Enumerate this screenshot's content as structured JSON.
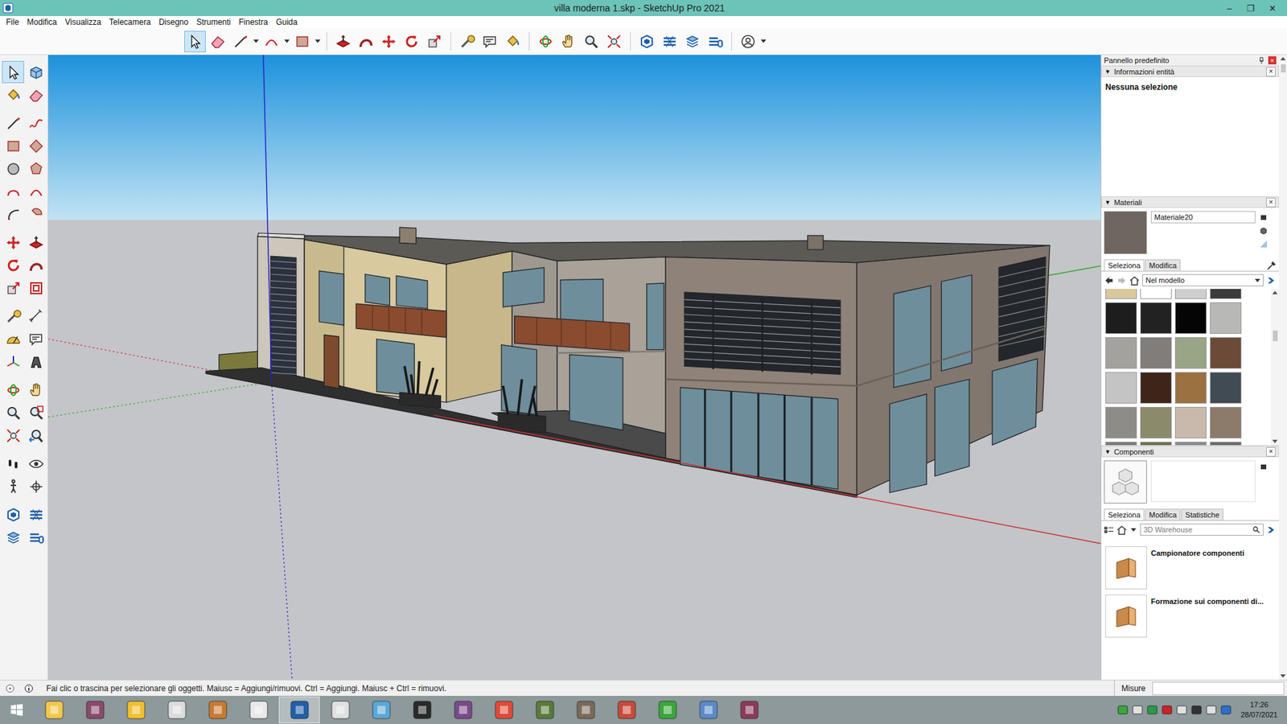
{
  "window": {
    "title": "villa moderna 1.skp - SketchUp Pro 2021",
    "controls": [
      "–",
      "❐",
      "✕"
    ]
  },
  "menu": [
    {
      "label": "File"
    },
    {
      "label": "Modifica"
    },
    {
      "label": "Visualizza"
    },
    {
      "label": "Telecamera"
    },
    {
      "label": "Disegno"
    },
    {
      "label": "Strumenti"
    },
    {
      "label": "Finestra"
    },
    {
      "label": "Guida"
    }
  ],
  "toolbar": [
    {
      "selected": true,
      "dropdown": false
    },
    {
      "selected": false,
      "dropdown": false
    },
    {
      "selected": false,
      "dropdown": true
    },
    {
      "selected": false,
      "dropdown": true
    },
    {
      "selected": false,
      "dropdown": true
    },
    {
      "selected": false,
      "dropdown": false
    },
    {
      "selected": false,
      "dropdown": false
    },
    {
      "selected": false,
      "dropdown": false
    },
    {
      "selected": false,
      "dropdown": false
    },
    {
      "selected": false,
      "dropdown": false
    },
    {
      "selected": false,
      "dropdown": false
    },
    {
      "selected": false,
      "dropdown": false
    },
    {
      "selected": false,
      "dropdown": false
    },
    {
      "selected": false,
      "dropdown": false
    },
    {
      "selected": false,
      "dropdown": false
    },
    {
      "selected": false,
      "dropdown": false
    },
    {
      "selected": false,
      "dropdown": false
    },
    {
      "selected": false,
      "dropdown": false
    },
    {
      "selected": false,
      "dropdown": false
    },
    {
      "selected": false,
      "dropdown": false
    },
    {
      "selected": false,
      "dropdown": false
    },
    {
      "selected": false,
      "dropdown": true
    }
  ],
  "palette": [
    {
      "selected": true
    },
    {
      "selected": false
    },
    {
      "selected": false
    },
    {
      "selected": false
    },
    {
      "selected": false
    },
    {
      "selected": false
    },
    {
      "selected": false
    },
    {
      "selected": false
    },
    {
      "selected": false
    },
    {
      "selected": false
    },
    {
      "selected": false
    },
    {
      "selected": false
    },
    {
      "selected": false
    },
    {
      "selected": false
    },
    {
      "selected": false
    },
    {
      "selected": false
    },
    {
      "selected": false
    },
    {
      "selected": false
    },
    {
      "selected": false
    },
    {
      "selected": false
    },
    {
      "selected": false
    },
    {
      "selected": false
    },
    {
      "selected": false
    },
    {
      "selected": false
    },
    {
      "selected": false
    },
    {
      "selected": false
    },
    {
      "selected": false
    },
    {
      "selected": false
    },
    {
      "selected": false
    },
    {
      "selected": false
    },
    {
      "selected": false
    },
    {
      "selected": false
    },
    {
      "selected": false
    },
    {
      "selected": false
    },
    {
      "selected": false
    },
    {
      "selected": false
    },
    {
      "selected": false
    },
    {
      "selected": false
    },
    {
      "selected": false
    },
    {
      "selected": false
    }
  ],
  "panel": {
    "title": "Pannello predefinito",
    "close": "×"
  },
  "entity_info": {
    "toggle": "▼",
    "title": "Informazioni entità",
    "close": "×",
    "selection": "Nessuna selezione"
  },
  "materials": {
    "toggle": "▼",
    "title": "Materiali",
    "close": "×",
    "name": "Materiale20",
    "preview_color": "#6f6660",
    "tabs": [
      {
        "label": "Seleziona",
        "selected": true
      },
      {
        "label": "Modifica",
        "selected": false
      }
    ],
    "collection": "Nel modello",
    "swatches": [
      {
        "color": "#d9c89c"
      },
      {
        "color": "#ffffff"
      },
      {
        "color": "#cfcfcf"
      },
      {
        "color": "#3b3b3b"
      },
      {
        "color": "#1d1d1d"
      },
      {
        "color": "#222222"
      },
      {
        "color": "#050505"
      },
      {
        "color": "#b8b8b6"
      },
      {
        "color": "#a3a29f"
      },
      {
        "color": "#807d7b"
      },
      {
        "color": "#9aa486"
      },
      {
        "color": "#6b4a37"
      },
      {
        "color": "#c4c4c4"
      },
      {
        "color": "#3e2519"
      },
      {
        "color": "#9c7142"
      },
      {
        "color": "#414b53"
      },
      {
        "color": "#8d8c88"
      },
      {
        "color": "#8b8a6b"
      },
      {
        "color": "#c9b9ad"
      },
      {
        "color": "#8c7b6b"
      },
      {
        "color": "#7b7b7b"
      },
      {
        "color": "#6b7151"
      },
      {
        "color": "#8b8b89"
      },
      {
        "color": "#6b6b69"
      }
    ]
  },
  "components": {
    "toggle": "▼",
    "title": "Componenti",
    "close": "×",
    "tabs": [
      {
        "label": "Seleziona",
        "selected": true
      },
      {
        "label": "Modifica",
        "selected": false
      },
      {
        "label": "Statistiche",
        "selected": false
      }
    ],
    "search": {
      "placeholder": "3D Warehouse"
    },
    "items": [
      {
        "title": "Campionatore componenti"
      },
      {
        "title": "Formazione sui componenti di..."
      }
    ]
  },
  "status_bar": {
    "hint": "Fai clic o trascina per selezionare gli oggetti. Maiusc = Aggiungi/rimuovi. Ctrl = Aggiungi. Maiusc + Ctrl = rimuovi.",
    "measure_label": "Misure"
  },
  "taskbar": {
    "apps": [
      {
        "selected": false
      },
      {
        "selected": false
      },
      {
        "selected": false
      },
      {
        "selected": false
      },
      {
        "selected": false
      },
      {
        "selected": false
      },
      {
        "selected": true
      },
      {
        "selected": false
      },
      {
        "selected": false
      },
      {
        "selected": false
      },
      {
        "selected": false
      },
      {
        "selected": false
      },
      {
        "selected": false
      },
      {
        "selected": false
      },
      {
        "selected": false
      },
      {
        "selected": false
      },
      {
        "selected": false
      },
      {
        "selected": false
      }
    ],
    "time": "17:26",
    "date": "28/07/2021"
  }
}
